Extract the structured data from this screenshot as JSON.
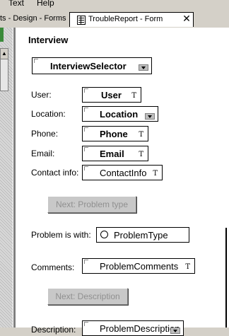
{
  "menubar": {
    "text_label": "Text",
    "help_label": "Help"
  },
  "tabs": {
    "inactive_label": "ts - Design - Forms",
    "active_label": "TroubleReport - Form",
    "close_glyph": "✕"
  },
  "form": {
    "title": "Interview",
    "interview_selector": "InterviewSelector",
    "fields": {
      "user_label": "User:",
      "user_value": "User",
      "location_label": "Location:",
      "location_value": "Location",
      "phone_label": "Phone:",
      "phone_value": "Phone",
      "email_label": "Email:",
      "email_value": "Email",
      "contact_label": "Contact info:",
      "contact_value": "ContactInfo",
      "problem_label": "Problem is with:",
      "problem_value": "ProblemType",
      "comments_label": "Comments:",
      "comments_value": "ProblemComments",
      "description_label": "Description:",
      "description_value": "ProblemDescription"
    },
    "buttons": {
      "next_problem": "Next: Problem type",
      "next_description": "Next: Description"
    },
    "text_marker": "T"
  }
}
